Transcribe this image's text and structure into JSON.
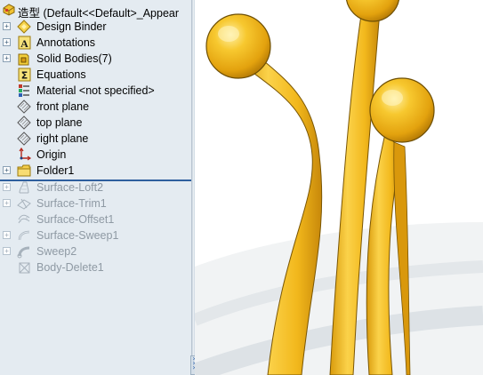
{
  "tree": {
    "root_label": "造型 (Default<<Default>_Appear",
    "items": [
      {
        "label": "Design Binder",
        "icon": "design-binder-icon",
        "suppressed": false
      },
      {
        "label": "Annotations",
        "icon": "annotations-icon",
        "suppressed": false
      },
      {
        "label": "Solid Bodies(7)",
        "icon": "solid-bodies-icon",
        "suppressed": false
      },
      {
        "label": "Equations",
        "icon": "equations-icon",
        "suppressed": false
      },
      {
        "label": "Material <not specified>",
        "icon": "material-icon",
        "suppressed": false
      },
      {
        "label": "front plane",
        "icon": "plane-icon",
        "suppressed": false
      },
      {
        "label": "top plane",
        "icon": "plane-icon",
        "suppressed": false
      },
      {
        "label": "right plane",
        "icon": "plane-icon",
        "suppressed": false
      },
      {
        "label": "Origin",
        "icon": "origin-icon",
        "suppressed": false
      },
      {
        "label": "Folder1",
        "icon": "folder-icon",
        "suppressed": false
      },
      {
        "label": "Surface-Loft2",
        "icon": "surface-loft-icon",
        "suppressed": true
      },
      {
        "label": "Surface-Trim1",
        "icon": "surface-trim-icon",
        "suppressed": true
      },
      {
        "label": "Surface-Offset1",
        "icon": "surface-offset-icon",
        "suppressed": true
      },
      {
        "label": "Surface-Sweep1",
        "icon": "surface-sweep-icon",
        "suppressed": true
      },
      {
        "label": "Sweep2",
        "icon": "sweep-icon",
        "suppressed": true
      },
      {
        "label": "Body-Delete1",
        "icon": "body-delete-icon",
        "suppressed": true
      }
    ]
  },
  "colors": {
    "panel_bg": "#e4ebf1",
    "rollback_bar": "#2e5f9e",
    "model_gold": "#f2b81c",
    "model_shadow": "#c98a0a",
    "model_highlight": "#fde27a",
    "viewport_bg": "#ffffff"
  }
}
